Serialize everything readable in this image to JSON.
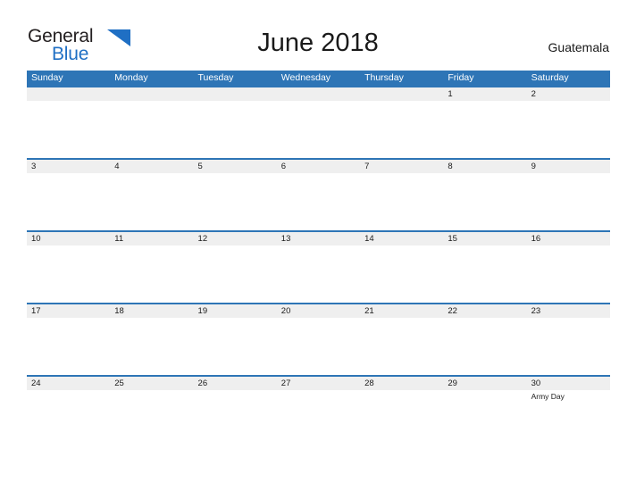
{
  "brand": {
    "name_part1": "General",
    "name_part2": "Blue",
    "flag_icon": "blue-triangle-flag-icon",
    "color_dark": "#231f20",
    "color_blue": "#1f6fc4"
  },
  "header": {
    "title": "June 2018",
    "country": "Guatemala"
  },
  "theme": {
    "header_blue": "#2e75b6",
    "band_gray": "#efefef",
    "text_dark": "#1a1a1a",
    "page_background": "#ffffff"
  },
  "calendar": {
    "month": "June",
    "year": "2018",
    "weekday_headers": [
      "Sunday",
      "Monday",
      "Tuesday",
      "Wednesday",
      "Thursday",
      "Friday",
      "Saturday"
    ],
    "weeks": [
      {
        "days": [
          {
            "num": "",
            "event": ""
          },
          {
            "num": "",
            "event": ""
          },
          {
            "num": "",
            "event": ""
          },
          {
            "num": "",
            "event": ""
          },
          {
            "num": "",
            "event": ""
          },
          {
            "num": "1",
            "event": ""
          },
          {
            "num": "2",
            "event": ""
          }
        ]
      },
      {
        "days": [
          {
            "num": "3",
            "event": ""
          },
          {
            "num": "4",
            "event": ""
          },
          {
            "num": "5",
            "event": ""
          },
          {
            "num": "6",
            "event": ""
          },
          {
            "num": "7",
            "event": ""
          },
          {
            "num": "8",
            "event": ""
          },
          {
            "num": "9",
            "event": ""
          }
        ]
      },
      {
        "days": [
          {
            "num": "10",
            "event": ""
          },
          {
            "num": "11",
            "event": ""
          },
          {
            "num": "12",
            "event": ""
          },
          {
            "num": "13",
            "event": ""
          },
          {
            "num": "14",
            "event": ""
          },
          {
            "num": "15",
            "event": ""
          },
          {
            "num": "16",
            "event": ""
          }
        ]
      },
      {
        "days": [
          {
            "num": "17",
            "event": ""
          },
          {
            "num": "18",
            "event": ""
          },
          {
            "num": "19",
            "event": ""
          },
          {
            "num": "20",
            "event": ""
          },
          {
            "num": "21",
            "event": ""
          },
          {
            "num": "22",
            "event": ""
          },
          {
            "num": "23",
            "event": ""
          }
        ]
      },
      {
        "days": [
          {
            "num": "24",
            "event": ""
          },
          {
            "num": "25",
            "event": ""
          },
          {
            "num": "26",
            "event": ""
          },
          {
            "num": "27",
            "event": ""
          },
          {
            "num": "28",
            "event": ""
          },
          {
            "num": "29",
            "event": ""
          },
          {
            "num": "30",
            "event": "Army Day"
          }
        ]
      }
    ]
  }
}
